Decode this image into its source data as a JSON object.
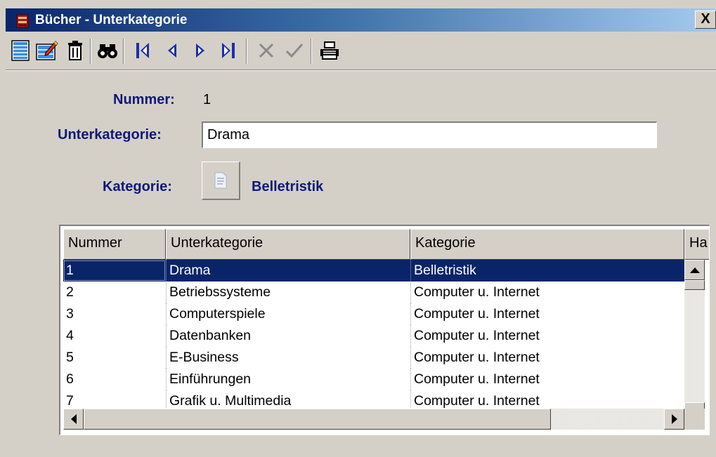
{
  "window": {
    "title": "Bücher - Unterkategorie",
    "close_label": "X"
  },
  "toolbar": {
    "icons": [
      "new-record-icon",
      "edit-record-icon",
      "delete-icon",
      "find-icon",
      "first-record-icon",
      "previous-record-icon",
      "next-record-icon",
      "last-record-icon",
      "cancel-icon",
      "confirm-icon",
      "print-icon"
    ]
  },
  "form": {
    "nummer_label": "Nummer:",
    "nummer_value": "1",
    "unterkategorie_label": "Unterkategorie:",
    "unterkategorie_value": "Drama",
    "kategorie_label": "Kategorie:",
    "kategorie_value": "Belletristik"
  },
  "grid": {
    "columns": [
      "Nummer",
      "Unterkategorie",
      "Kategorie",
      "Ha"
    ],
    "rows": [
      {
        "nummer": "1",
        "unterkategorie": "Drama",
        "kategorie": "Belletristik"
      },
      {
        "nummer": "2",
        "unterkategorie": "Betriebssysteme",
        "kategorie": "Computer u. Internet"
      },
      {
        "nummer": "3",
        "unterkategorie": "Computerspiele",
        "kategorie": "Computer u. Internet"
      },
      {
        "nummer": "4",
        "unterkategorie": "Datenbanken",
        "kategorie": "Computer u. Internet"
      },
      {
        "nummer": "5",
        "unterkategorie": "E-Business",
        "kategorie": "Computer u. Internet"
      },
      {
        "nummer": "6",
        "unterkategorie": "Einführungen",
        "kategorie": "Computer u. Internet"
      },
      {
        "nummer": "7",
        "unterkategorie": "Grafik u. Multimedia",
        "kategorie": "Computer u. Internet"
      }
    ],
    "selected_row": 0
  },
  "colors": {
    "title_start": "#0a246a",
    "title_end": "#a6caf0",
    "label": "#10187a",
    "selection": "#0a246a",
    "face": "#d4d0c8"
  }
}
